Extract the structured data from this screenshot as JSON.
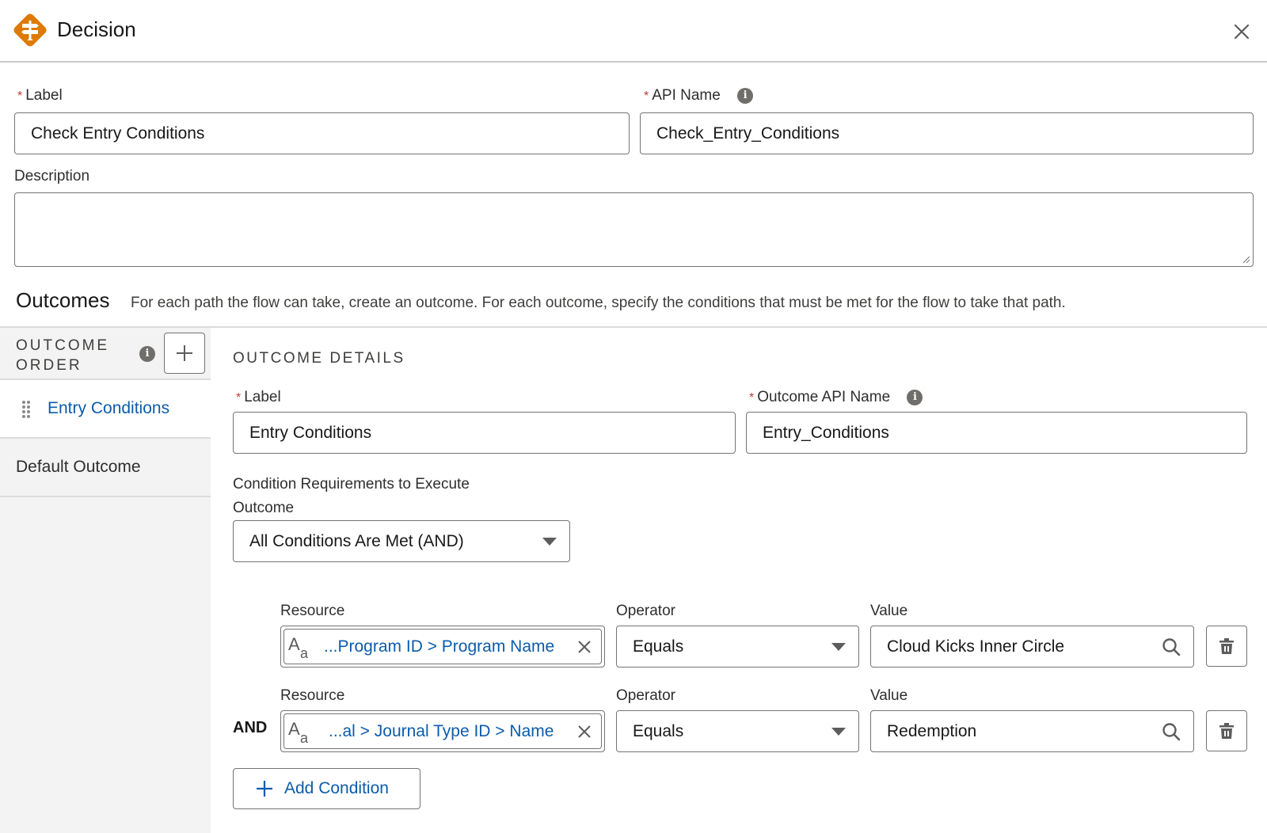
{
  "header": {
    "title": "Decision",
    "icon": "decision-signpost-icon",
    "close_icon": "close-icon",
    "accent_color": "#dd7a01"
  },
  "form": {
    "label": {
      "label": "Label",
      "required": "*",
      "value": "Check Entry Conditions"
    },
    "api_name": {
      "label": "API Name",
      "required": "*",
      "value": "Check_Entry_Conditions",
      "info_icon": "i"
    },
    "description": {
      "label": "Description",
      "value": ""
    }
  },
  "outcomes": {
    "title": "Outcomes",
    "description": "For each path the flow can take, create an outcome. For each outcome, specify the conditions that must be met for the flow to take that path."
  },
  "sidebar": {
    "header_line1": "OUTCOME",
    "header_line2": "ORDER",
    "info_icon": "i",
    "add_label": "+",
    "items": [
      {
        "label": "Entry Conditions",
        "active": true
      },
      {
        "label": "Default Outcome",
        "active": false
      }
    ]
  },
  "details": {
    "title": "OUTCOME DETAILS",
    "label": {
      "label": "Label",
      "required": "*",
      "value": "Entry Conditions"
    },
    "api_name": {
      "label": "Outcome API Name",
      "required": "*",
      "value": "Entry_Conditions",
      "info_icon": "i"
    },
    "requirements_label_line1": "Condition Requirements to Execute",
    "requirements_label_line2": "Outcome",
    "requirements_value": "All Conditions Are Met (AND)",
    "conditions": [
      {
        "prefix": "",
        "resource_label": "Resource",
        "resource_value": "...Program ID > Program Name",
        "operator_label": "Operator",
        "operator_value": "Equals",
        "value_label": "Value",
        "value_value": "Cloud Kicks Inner Circle"
      },
      {
        "prefix": "AND",
        "resource_label": "Resource",
        "resource_value": "...al > Journal Type ID > Name",
        "operator_label": "Operator",
        "operator_value": "Equals",
        "value_label": "Value",
        "value_value": "Redemption"
      }
    ],
    "add_condition_label": "Add Condition"
  }
}
